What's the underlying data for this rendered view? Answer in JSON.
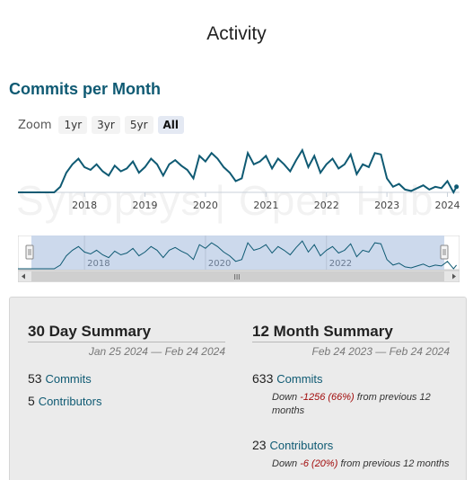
{
  "page": {
    "title": "Activity"
  },
  "section": {
    "title": "Commits per Month"
  },
  "zoom": {
    "label": "Zoom",
    "buttons": [
      "1yr",
      "3yr",
      "5yr",
      "All"
    ],
    "active": "All"
  },
  "watermark": "Synopsys | Open Hub",
  "colors": {
    "line": "#0f5a73",
    "navigator_fill": "#c7d5ea",
    "heading_link": "#0f5a73",
    "negative": "#a10a0a"
  },
  "chart_data": {
    "type": "line",
    "title": "Commits per Month",
    "xlabel": "",
    "ylabel": "",
    "x_ticks": [
      "2018",
      "2019",
      "2020",
      "2021",
      "2022",
      "2023",
      "2024"
    ],
    "nav_ticks": [
      "2018",
      "2020",
      "2022"
    ],
    "x_range": [
      2016.9,
      2024.2
    ],
    "series": [
      {
        "x": [
          2016.9,
          2017.0,
          2017.1,
          2017.2,
          2017.3,
          2017.4,
          2017.5,
          2017.6,
          2017.7,
          2017.8,
          2017.9,
          2018.0,
          2018.1,
          2018.2,
          2018.3,
          2018.4,
          2018.5,
          2018.6,
          2018.7,
          2018.8,
          2018.9,
          2019.0,
          2019.1,
          2019.2,
          2019.3,
          2019.4,
          2019.5,
          2019.6,
          2019.7,
          2019.8,
          2019.9,
          2020.0,
          2020.1,
          2020.2,
          2020.3,
          2020.4,
          2020.5,
          2020.6,
          2020.7,
          2020.8,
          2020.9,
          2021.0,
          2021.1,
          2021.2,
          2021.3,
          2021.4,
          2021.5,
          2021.6,
          2021.7,
          2021.8,
          2021.9,
          2022.0,
          2022.1,
          2022.2,
          2022.3,
          2022.4,
          2022.5,
          2022.6,
          2022.7,
          2022.8,
          2022.9,
          2023.0,
          2023.1,
          2023.2,
          2023.3,
          2023.4,
          2023.5,
          2023.6,
          2023.7,
          2023.8,
          2023.9,
          2024.0,
          2024.1,
          2024.15
        ],
        "values": [
          0,
          0,
          0,
          0,
          0,
          0,
          0,
          4,
          14,
          20,
          24,
          18,
          16,
          20,
          15,
          12,
          19,
          15,
          17,
          22,
          14,
          18,
          24,
          20,
          12,
          20,
          23,
          19,
          16,
          10,
          26,
          22,
          28,
          24,
          18,
          14,
          8,
          10,
          28,
          20,
          22,
          26,
          17,
          24,
          20,
          15,
          23,
          30,
          18,
          26,
          14,
          20,
          24,
          17,
          20,
          27,
          13,
          20,
          18,
          28,
          27,
          10,
          4,
          6,
          2,
          1,
          3,
          5,
          2,
          4,
          3,
          8,
          0,
          4
        ]
      }
    ],
    "ylim": [
      0,
      32
    ],
    "grid": false
  },
  "summary30": {
    "heading": "30 Day Summary",
    "dates": "Jan 25 2024 — Feb 24 2024",
    "commits_count": "53",
    "commits_label": "Commits",
    "contributors_count": "5",
    "contributors_label": "Contributors"
  },
  "summary12": {
    "heading": "12 Month Summary",
    "dates": "Feb 24 2023 — Feb 24 2024",
    "commits_count": "633",
    "commits_label": "Commits",
    "commits_change_prefix": "Down",
    "commits_change_value": "-1256 (66%)",
    "commits_change_suffix": "from previous 12 months",
    "contributors_count": "23",
    "contributors_label": "Contributors",
    "contributors_change_prefix": "Down",
    "contributors_change_value": "-6 (20%)",
    "contributors_change_suffix": "from previous 12 months"
  }
}
